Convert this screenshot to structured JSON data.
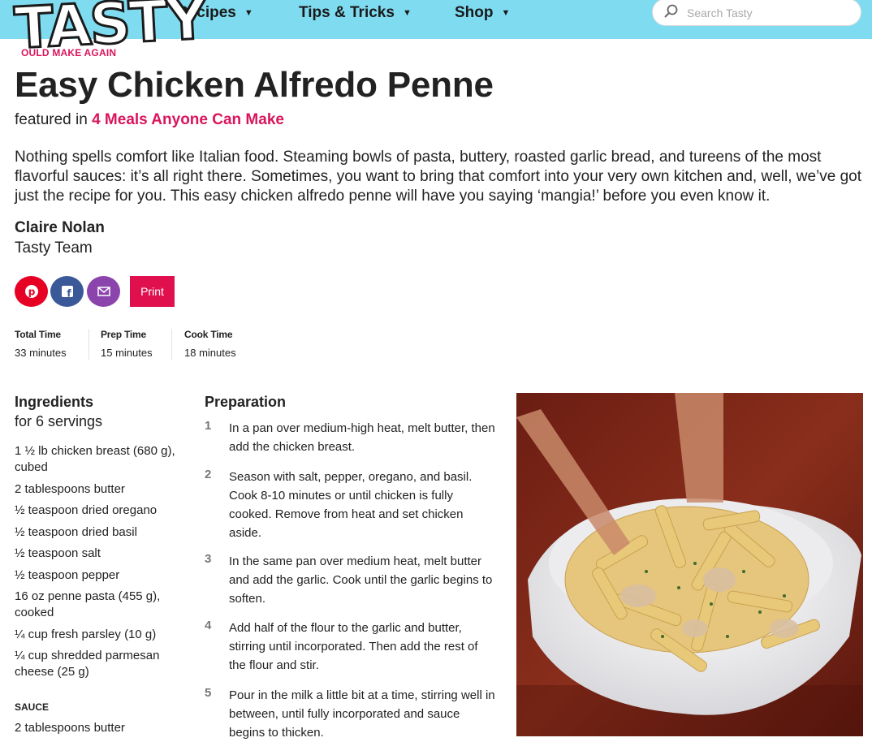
{
  "header": {
    "logo": "TASTY",
    "nav": [
      {
        "label": "Recipes"
      },
      {
        "label": "Tips & Tricks"
      },
      {
        "label": "Shop"
      }
    ],
    "search_placeholder": "Search Tasty",
    "colors": {
      "bar": "#7fdbf0",
      "accent": "#d9155b"
    }
  },
  "recipe": {
    "would_make_again": "OULD MAKE AGAIN",
    "title": "Easy Chicken Alfredo Penne",
    "featured_prefix": "featured in",
    "featured_link": "4 Meals Anyone Can Make",
    "description": "Nothing spells comfort like Italian food. Steaming bowls of pasta, buttery, roasted garlic bread, and tureens of the most flavorful sauces: it’s all right there. Sometimes, you want to bring that comfort into your very own kitchen and, well, we’ve got just the recipe for you. This easy chicken alfredo penne will have you saying ‘mangia!’ before you even know it.",
    "author": "Claire Nolan",
    "team": "Tasty Team"
  },
  "share": {
    "print_label": "Print",
    "icons": [
      "pinterest-icon",
      "facebook-icon",
      "email-icon"
    ],
    "colors": {
      "pinterest": "#e60023",
      "facebook": "#3b5998",
      "email": "#8b44ac",
      "print": "#e0104f"
    }
  },
  "times": [
    {
      "label": "Total Time",
      "value": "33 minutes"
    },
    {
      "label": "Prep Time",
      "value": "15 minutes"
    },
    {
      "label": "Cook Time",
      "value": "18 minutes"
    }
  ],
  "ingredients": {
    "heading": "Ingredients",
    "servings": "for 6 servings",
    "items": [
      "1 ½ lb chicken breast (680 g), cubed",
      "2 tablespoons butter",
      "½ teaspoon dried oregano",
      "½ teaspoon dried basil",
      "½ teaspoon salt",
      "½ teaspoon pepper",
      "16 oz penne pasta (455 g), cooked",
      "¼ cup fresh parsley (10 g)",
      "¼ cup shredded parmesan cheese (25 g)"
    ],
    "sauce_heading": "SAUCE",
    "sauce_items": [
      "2 tablespoons butter"
    ]
  },
  "preparation": {
    "heading": "Preparation",
    "steps": [
      {
        "num": "1",
        "text": "In a pan over medium-high heat, melt butter, then add the chicken breast."
      },
      {
        "num": "2",
        "text": "Season with salt, pepper, oregano, and basil. Cook 8-10 minutes or until chicken is fully cooked. Remove from heat and set chicken aside."
      },
      {
        "num": "3",
        "text": "In the same pan over medium heat, melt butter and add the garlic. Cook until the garlic begins to soften."
      },
      {
        "num": "4",
        "text": "Add half of the flour to the garlic and butter, stirring until incorporated. Then add the rest of the flour and stir."
      },
      {
        "num": "5",
        "text": "Pour in the milk a little bit at a time, stirring well in between, until fully incorporated and sauce begins to thicken."
      }
    ]
  }
}
